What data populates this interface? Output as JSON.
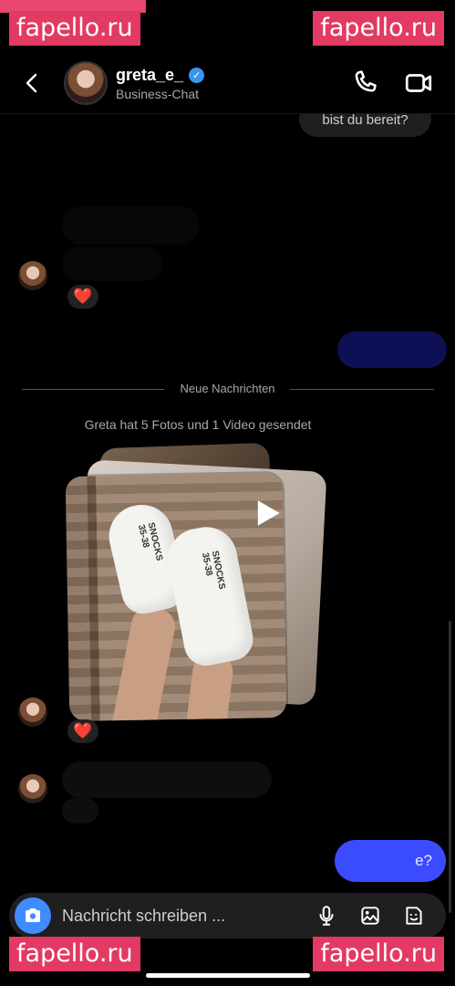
{
  "watermarks": {
    "top_left": "fapello.ru",
    "top_right": "fapello.ru",
    "bottom_left": "fapello.ru",
    "bottom_right": "fapello.ru"
  },
  "header": {
    "username": "greta_e_",
    "subtitle": "Business-Chat",
    "verified": true
  },
  "messages": {
    "top_sent_text": "bist du bereit?",
    "divider_text": "Neue Nachrichten",
    "media_note": "Greta hat 5 Fotos und 1 Video gesendet",
    "reaction": "❤️",
    "bottom_sent_text": "e?",
    "sock_text": "SNOCKS 35-38"
  },
  "composer": {
    "placeholder": "Nachricht schreiben ..."
  },
  "colors": {
    "background": "#000000",
    "outgoing_bubble": "#3b4bff",
    "camera_button": "#3e8cff",
    "verified": "#3897f0"
  },
  "icons": [
    "back-icon",
    "phone-icon",
    "video-icon",
    "play-icon",
    "camera-icon",
    "microphone-icon",
    "gallery-icon",
    "sticker-icon"
  ]
}
